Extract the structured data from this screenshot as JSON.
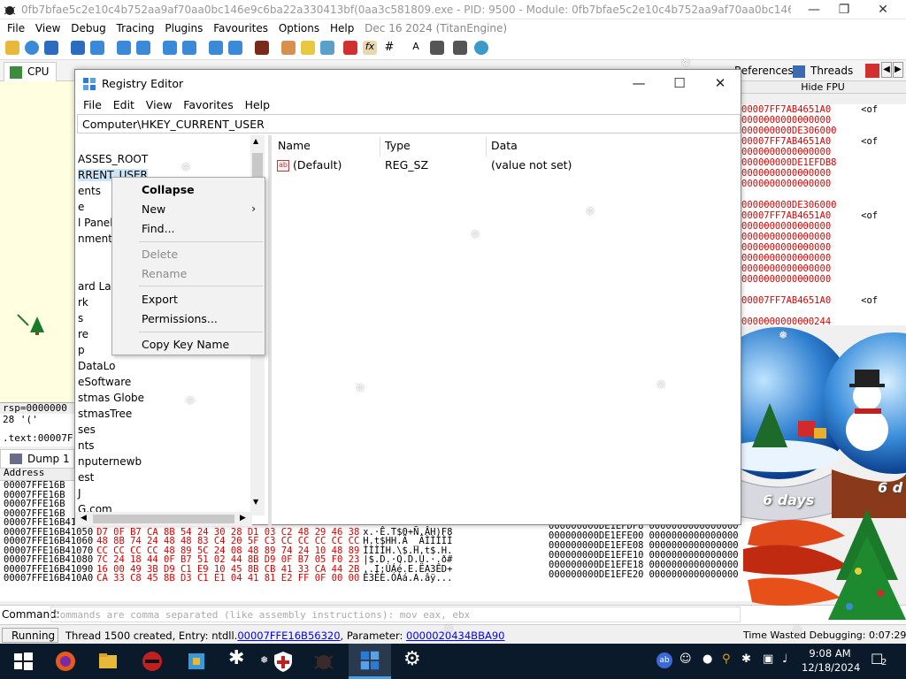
{
  "dbg": {
    "title": "0fb7bfae5c2e10c4b752aa9af70aa0bc146e9c6ba22a330413bf(0aa3c581809.exe - PID: 9500 - Module: 0fb7bfae5c2e10c4b752aa9af70aa0bc146e9c6ba22a330413bfc0a...",
    "menu": [
      "File",
      "View",
      "Debug",
      "Tracing",
      "Plugins",
      "Favourites",
      "Options",
      "Help",
      "Dec 16 2024 (TitanEngine)"
    ],
    "tabs": {
      "cpu": "CPU",
      "references": "References",
      "threads": "Threads",
      "dump1": "Dump 1"
    },
    "hide_fpu": "Hide FPU",
    "reg_lines": [
      "rsp=0000000",
      "28 '('",
      ".text:00007F"
    ],
    "dump_header": "Address",
    "dump_rows": [
      {
        "addr": "00007FFE16B",
        "hex": "",
        "ascii": ""
      },
      {
        "addr": "00007FFE16B",
        "hex": "",
        "ascii": ""
      },
      {
        "addr": "00007FFE16B",
        "hex": "",
        "ascii": ""
      },
      {
        "addr": "00007FFE16B",
        "hex": "",
        "ascii": ""
      },
      {
        "addr": "00007FFE16B41040",
        "hex": "",
        "ascii": ""
      },
      {
        "addr": "00007FFE16B41050",
        "hex": "D7 0F B7 CA 8B 54 24 30 28 D1 03 C2 48 29 46 38",
        "ascii": "x.·Ê.T$0+Ñ.ÂH)F8"
      },
      {
        "addr": "00007FFE16B41060",
        "hex": "48 8B 74 24 48 48 83 C4 20 5F C3 CC CC CC CC CC",
        "ascii": "H.t$HH.Ä _ÃÌÌÌÌÌ"
      },
      {
        "addr": "00007FFE16B41070",
        "hex": "CC CC CC CC 48 89 5C 24 08 48 89 74 24 10 48 89",
        "ascii": "ÌÌÌÌH.\\$.H.t$.H."
      },
      {
        "addr": "00007FFE16B41080",
        "hex": "7C 24 18 44 0F B7 51 02 44 8B D9 0F B7 05 F0 23",
        "ascii": "|$.D.·Q.D.Ù.·.ð#"
      },
      {
        "addr": "00007FFE16B41090",
        "hex": "16 00 49 3B D9 C1 E9 10 45 8B CB 41 33 CA 44 2B",
        "ascii": "..I;ÙÁé.E.ËA3ÊD+"
      },
      {
        "addr": "00007FFE16B410A0",
        "hex": "CA 33 C8 45 8B D3 C1 E1 04 41 81 E2 FF 0F 00 00",
        "ascii": "Ê3ÈE.ÓÁá.A.âÿ..."
      }
    ],
    "stack_rows": [
      {
        "v": "00007FF7AB4651A0",
        "c": "<of"
      },
      {
        "v": "0000000000000000",
        "c": ""
      },
      {
        "v": "000000000DE306000",
        "c": ""
      },
      {
        "v": "00007FF7AB4651A0",
        "c": "<of"
      },
      {
        "v": "0000000000000000",
        "c": ""
      },
      {
        "v": "000000000DE1EFDB8",
        "c": ""
      },
      {
        "v": "0000000000000000",
        "c": ""
      },
      {
        "v": "0000000000000000",
        "c": ""
      },
      {
        "v": "",
        "c": ""
      },
      {
        "v": "000000000DE306000",
        "c": ""
      },
      {
        "v": "00007FF7AB4651A0",
        "c": "<of"
      },
      {
        "v": "0000000000000000",
        "c": ""
      },
      {
        "v": "0000000000000000",
        "c": ""
      },
      {
        "v": "0000000000000000",
        "c": ""
      },
      {
        "v": "0000000000000000",
        "c": ""
      },
      {
        "v": "0000000000000000",
        "c": ""
      },
      {
        "v": "0000000000000000",
        "c": ""
      },
      {
        "v": "",
        "c": ""
      },
      {
        "v": "00007FF7AB4651A0",
        "c": "<of"
      },
      {
        "v": "",
        "c": ""
      },
      {
        "v": "0000000000000244",
        "c": ""
      }
    ],
    "stack2_rows": [
      {
        "a": "000000000DE1EFDF8",
        "b": "0000000000000000"
      },
      {
        "a": "000000000DE1EFE00",
        "b": "0000000000000000"
      },
      {
        "a": "000000000DE1EFE08",
        "b": "0000000000000000"
      },
      {
        "a": "000000000DE1EFE10",
        "b": "0000000000000000"
      },
      {
        "a": "000000000DE1EFE18",
        "b": "0000000000000000"
      },
      {
        "a": "000000000DE1EFE20",
        "b": "0000000000000000"
      }
    ],
    "command_label": "Command:",
    "command_placeholder": "Commands are comma separated (like assembly instructions): mov eax, ebx",
    "status": {
      "state": "Running",
      "msg_prefix": "Thread 1500 created, Entry: ntdll.",
      "entry_link": "00007FFE16B56320",
      "msg_mid": ", Parameter: ",
      "param_link": "0000020434BBA90",
      "time_wasted": "Time Wasted Debugging:  0:07:29"
    }
  },
  "regedit": {
    "title": "Registry Editor",
    "menu": [
      "File",
      "Edit",
      "View",
      "Favorites",
      "Help"
    ],
    "path": "Computer\\HKEY_CURRENT_USER",
    "tree": [
      "ASSES_ROOT",
      "RRENT_USER",
      "ents",
      "e",
      "l Panel",
      "nment",
      "",
      "",
      "ard Layo",
      "rk",
      "s",
      "re",
      "p",
      "DataLo",
      "eSoftware",
      "stmas Globe",
      "stmasTree",
      "ses",
      "nts",
      "nputernewb",
      "est",
      "J",
      "G.com",
      "gle"
    ],
    "columns": [
      "Name",
      "Type",
      "Data"
    ],
    "rows": [
      {
        "name": "(Default)",
        "type": "REG_SZ",
        "data": "(value not set)"
      }
    ]
  },
  "context_menu": {
    "collapse": "Collapse",
    "new": "New",
    "find": "Find...",
    "delete": "Delete",
    "rename": "Rename",
    "export": "Export",
    "permissions": "Permissions...",
    "copy_key_name": "Copy Key Name"
  },
  "decor": {
    "days_label": "6 days",
    "days_label_2": "6 d"
  },
  "taskbar": {
    "time": "9:08 AM",
    "date": "12/18/2024",
    "notifications": "2"
  }
}
